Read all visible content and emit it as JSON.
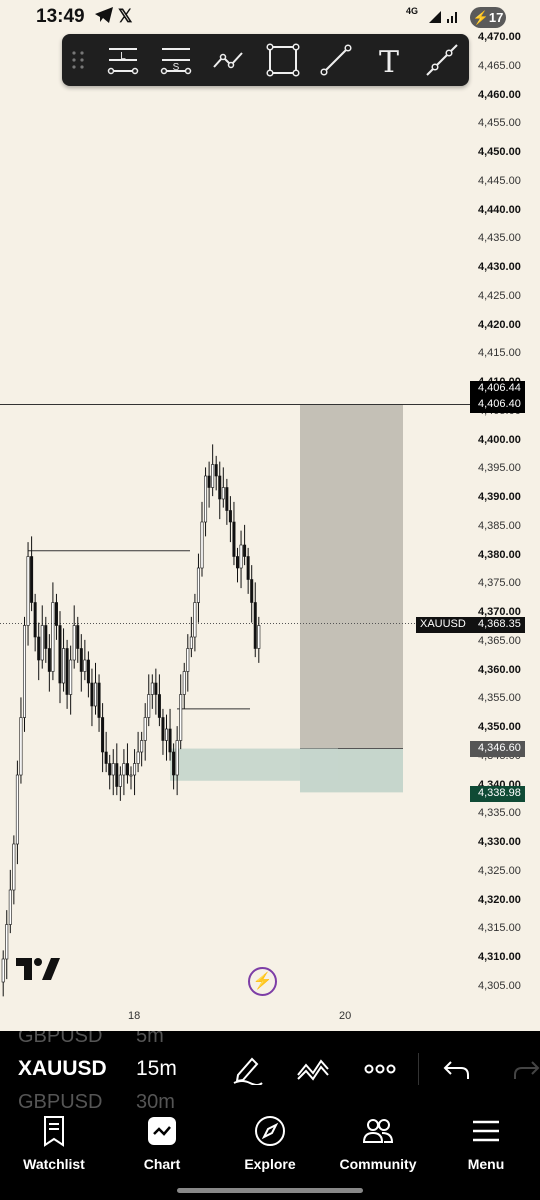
{
  "status_bar": {
    "time": "13:49",
    "network": "4G",
    "battery": "17",
    "icons": [
      "telegram-icon",
      "x-icon",
      "signal-icon",
      "battery-charging-icon"
    ]
  },
  "drawing_toolbar": {
    "tools": [
      {
        "name": "long-position-tool",
        "letter": "L"
      },
      {
        "name": "short-position-tool",
        "letter": "S"
      },
      {
        "name": "path-tool",
        "letter": ""
      },
      {
        "name": "rectangle-tool",
        "letter": ""
      },
      {
        "name": "trend-line-tool",
        "letter": ""
      },
      {
        "name": "text-tool",
        "letter": "T"
      },
      {
        "name": "ray-tool",
        "letter": ""
      }
    ]
  },
  "price_axis": {
    "ticks": [
      "4,470.00",
      "4,465.00",
      "4,460.00",
      "4,455.00",
      "4,450.00",
      "4,445.00",
      "4,440.00",
      "4,435.00",
      "4,430.00",
      "4,425.00",
      "4,420.00",
      "4,415.00",
      "4,410.00",
      "4,405.00",
      "4,400.00",
      "4,395.00",
      "4,390.00",
      "4,385.00",
      "4,380.00",
      "4,375.00",
      "4,370.00",
      "4,365.00",
      "4,360.00",
      "4,355.00",
      "4,350.00",
      "4,345.00",
      "4,340.00",
      "4,335.00",
      "4,330.00",
      "4,325.00",
      "4,320.00",
      "4,315.00",
      "4,310.00",
      "4,305.00"
    ],
    "tags": {
      "target_top": "4,406.44",
      "target_bottom": "4,406.40",
      "current": "4,368.35",
      "entry": "4,346.60",
      "stop": "4,338.98"
    },
    "symbol_tag": "XAUUSD"
  },
  "date_axis": {
    "labels": [
      "18",
      "20"
    ]
  },
  "lower_toolbar": {
    "symbol": "XAUUSD",
    "interval": "15m",
    "ghost_above_symbol": "GBPUSD",
    "ghost_above_interval": "5m",
    "ghost_below_symbol": "GBPUSD",
    "ghost_below_interval": "30m"
  },
  "bottom_nav": {
    "items": [
      {
        "label": "Watchlist",
        "icon": "bookmark-icon"
      },
      {
        "label": "Chart",
        "icon": "chart-icon"
      },
      {
        "label": "Explore",
        "icon": "compass-icon"
      },
      {
        "label": "Community",
        "icon": "people-icon"
      },
      {
        "label": "Menu",
        "icon": "hamburger-icon"
      }
    ]
  },
  "chart_data": {
    "type": "candlestick",
    "symbol": "XAUUSD",
    "interval": "15m",
    "ylim": [
      4302,
      4472
    ],
    "current_price": 4368.35,
    "position": {
      "target": 4406.44,
      "entry": 4346.6,
      "stop": 4338.98
    },
    "closes": [
      4310,
      4316,
      4322,
      4330,
      4342,
      4352,
      4368,
      4380,
      4372,
      4366,
      4362,
      4368,
      4364,
      4360,
      4372,
      4368,
      4358,
      4364,
      4356,
      4362,
      4368,
      4364,
      4360,
      4362,
      4358,
      4354,
      4358,
      4352,
      4346,
      4344,
      4342,
      4344,
      4340,
      4342,
      4344,
      4342,
      4342,
      4344,
      4346,
      4348,
      4352,
      4356,
      4358,
      4356,
      4352,
      4348,
      4350,
      4346,
      4342,
      4348,
      4356,
      4360,
      4364,
      4366,
      4372,
      4378,
      4386,
      4394,
      4392,
      4396,
      4394,
      4390,
      4392,
      4388,
      4386,
      4380,
      4378,
      4382,
      4380,
      4376,
      4372,
      4364,
      4368
    ],
    "colors": {
      "bull": "#ffffff",
      "bear": "#111111",
      "target_zone": "#c4c0b6",
      "stop_zone": "#c6d6cc",
      "background": "#f6f1e6"
    }
  }
}
